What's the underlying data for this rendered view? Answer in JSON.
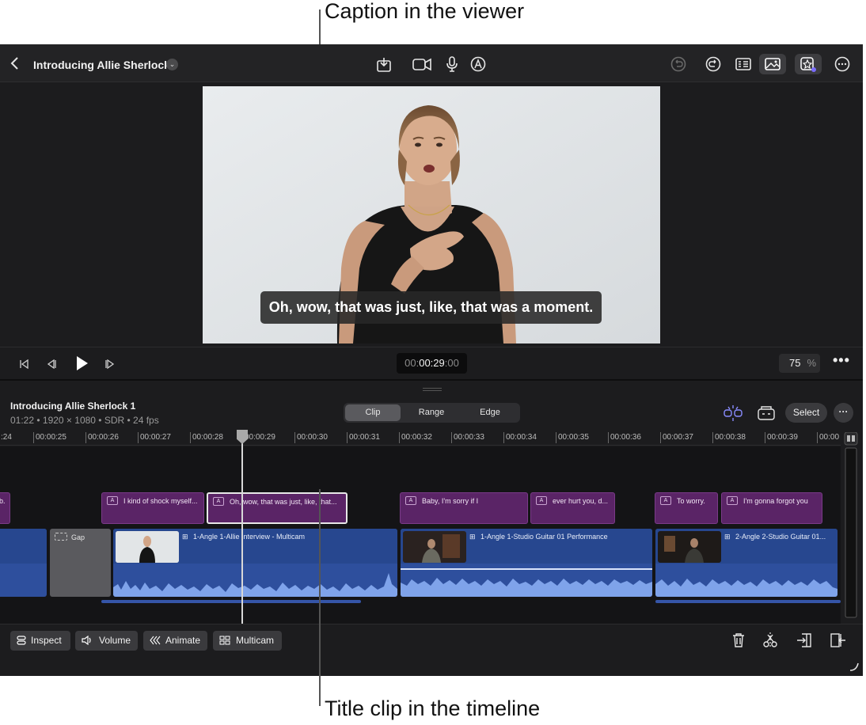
{
  "annotations": {
    "top": "Caption in the viewer",
    "bottom": "Title clip in the timeline"
  },
  "toolbar": {
    "project_title": "Introducing Allie Sherlock",
    "icons": [
      "back-chevron-icon",
      "project-menu-chevron-icon",
      "share-export-icon",
      "camera-icon",
      "microphone-icon",
      "voiceover-a-icon",
      "undo-icon",
      "redo-icon",
      "inspector-icon",
      "photo-browser-icon",
      "effects-star-icon",
      "more-options-icon"
    ]
  },
  "viewer": {
    "caption": "Oh, wow, that was just, like, that was a moment."
  },
  "transport": {
    "timecode_dim_prefix": "00:",
    "timecode_bright": "00:29",
    "timecode_dim_suffix": ":00",
    "zoom_value": "75",
    "zoom_unit": "%"
  },
  "timeline": {
    "name": "Introducing Allie Sherlock 1",
    "info": "01:22 • 1920 × 1080 • SDR • 24 fps",
    "modes": [
      "Clip",
      "Range",
      "Edge"
    ],
    "active_mode": "Clip",
    "select_label": "Select",
    "ruler": [
      ":24",
      "00:00:25",
      "00:00:26",
      "00:00:27",
      "00:00:28",
      "00:00:29",
      "00:00:30",
      "00:00:31",
      "00:00:32",
      "00:00:33",
      "00:00:34",
      "00:00:35",
      "00:00:36",
      "00:00:37",
      "00:00:38",
      "00:00:39",
      "00:00"
    ],
    "title_clips": [
      {
        "label": "b.",
        "selected": false
      },
      {
        "label": "I kind of shock myself...",
        "selected": false
      },
      {
        "label": "Oh, wow, that was just, like, that...",
        "selected": true
      },
      {
        "label": "Baby, I'm sorry if I",
        "selected": false
      },
      {
        "label": "ever hurt you, d...",
        "selected": false
      },
      {
        "label": "To worry.",
        "selected": false
      },
      {
        "label": "I'm gonna forgot you",
        "selected": false
      }
    ],
    "gap_label": "Gap",
    "video_clips": [
      {
        "label": "1-Angle 1-Allie Interview - Multicam"
      },
      {
        "label": "1-Angle 1-Studio Guitar 01 Performance"
      },
      {
        "label": "2-Angle 2-Studio Guitar 01..."
      }
    ]
  },
  "bottombar": {
    "inspect": "Inspect",
    "volume": "Volume",
    "animate": "Animate",
    "multicam": "Multicam"
  },
  "colors": {
    "app_bg": "#1c1c1e",
    "title_clip": "#5a2466",
    "video_clip": "#2e4f9d",
    "gap_clip": "#5a5a5e"
  }
}
